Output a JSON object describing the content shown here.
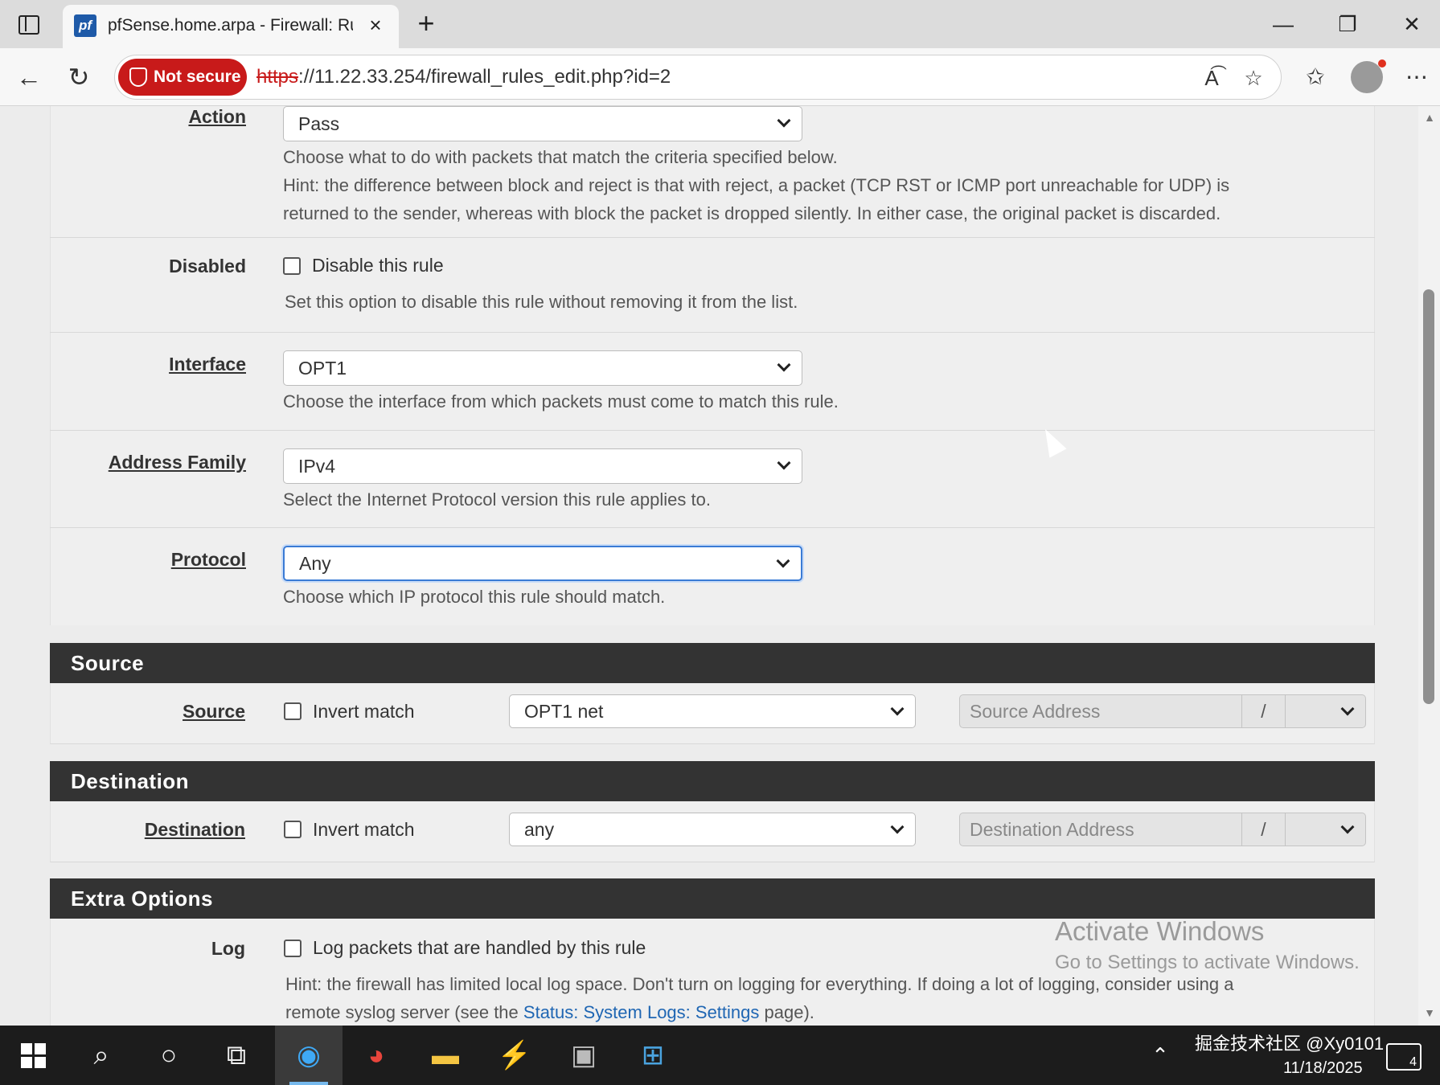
{
  "browser": {
    "tab_title": "pfSense.home.arpa - Firewall: Rule",
    "favicon_text": "pf",
    "security_label": "Not secure",
    "url_scheme": "https",
    "url_rest": "://11.22.33.254/firewall_rules_edit.php?id=2"
  },
  "form": {
    "action": {
      "label": "Action",
      "value": "Pass",
      "help1": "Choose what to do with packets that match the criteria specified below.",
      "help2": "Hint: the difference between block and reject is that with reject, a packet (TCP RST or ICMP port unreachable for UDP) is",
      "help3": "returned to the sender, whereas with block the packet is dropped silently. In either case, the original packet is discarded."
    },
    "disabled": {
      "label": "Disabled",
      "checkbox_label": "Disable this rule",
      "help": "Set this option to disable this rule without removing it from the list."
    },
    "interface": {
      "label": "Interface",
      "value": "OPT1",
      "help": "Choose the interface from which packets must come to match this rule."
    },
    "address_family": {
      "label": "Address Family",
      "value": "IPv4",
      "help": "Select the Internet Protocol version this rule applies to."
    },
    "protocol": {
      "label": "Protocol",
      "value": "Any",
      "help": "Choose which IP protocol this rule should match."
    }
  },
  "source": {
    "header": "Source",
    "label": "Source",
    "invert_label": "Invert match",
    "type_value": "OPT1 net",
    "address_placeholder": "Source Address",
    "slash": "/"
  },
  "destination": {
    "header": "Destination",
    "label": "Destination",
    "invert_label": "Invert match",
    "type_value": "any",
    "address_placeholder": "Destination Address",
    "slash": "/"
  },
  "extra": {
    "header": "Extra Options",
    "log_label": "Log",
    "log_checkbox_label": "Log packets that are handled by this rule",
    "hint1": "Hint: the firewall has limited local log space. Don't turn on logging for everything. If doing a lot of logging, consider using a",
    "hint2_pre": "remote syslog server (see the ",
    "hint2_link": "Status: System Logs: Settings",
    "hint2_post": " page)."
  },
  "watermark": {
    "line1": "Activate Windows",
    "line2": "Go to Settings to activate Windows."
  },
  "taskbar": {
    "tray_text": "掘金技术社区 @Xy0101",
    "date": "11/18/2025",
    "notification_count": "4"
  }
}
